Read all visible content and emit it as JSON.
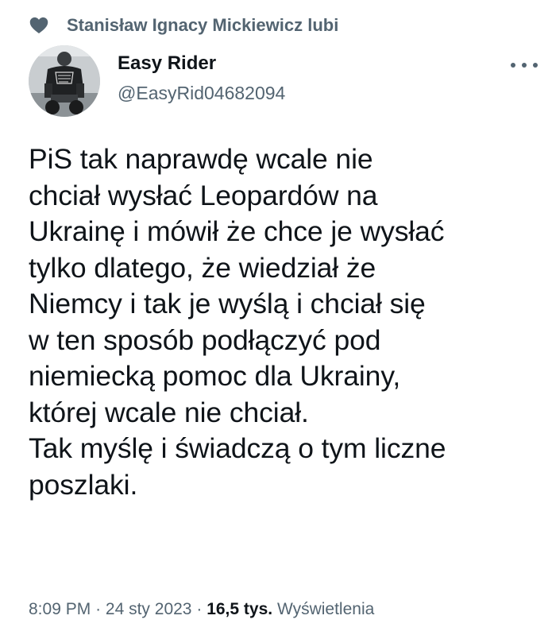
{
  "social_context": {
    "icon": "heart-icon",
    "text": "Stanisław Ignacy Mickiewicz lubi"
  },
  "author": {
    "avatar_icon": "avatar",
    "display_name": "Easy Rider",
    "handle": "@EasyRid04682094"
  },
  "more_icon": "more-options-icon",
  "tweet": {
    "text": "PiS tak naprawdę wcale nie\nchciał wysłać Leopardów na\nUkrainę i mówił że chce je wysłać\ntylko dlatego, że wiedział że\nNiemcy i tak je wyślą i chciał się\nw ten sposób podłączyć pod\nniemiecką pomoc dla Ukrainy,\nktórej wcale nie chciał.\nTak myślę i świadczą o tym liczne\nposzlaki."
  },
  "meta": {
    "time": "8:09 PM",
    "separator": "·",
    "date": "24 sty 2023",
    "views_count": "16,5 tys.",
    "views_label": "Wyświetlenia"
  },
  "colors": {
    "text_primary": "#0f1419",
    "text_secondary": "#536471",
    "background": "#ffffff"
  }
}
